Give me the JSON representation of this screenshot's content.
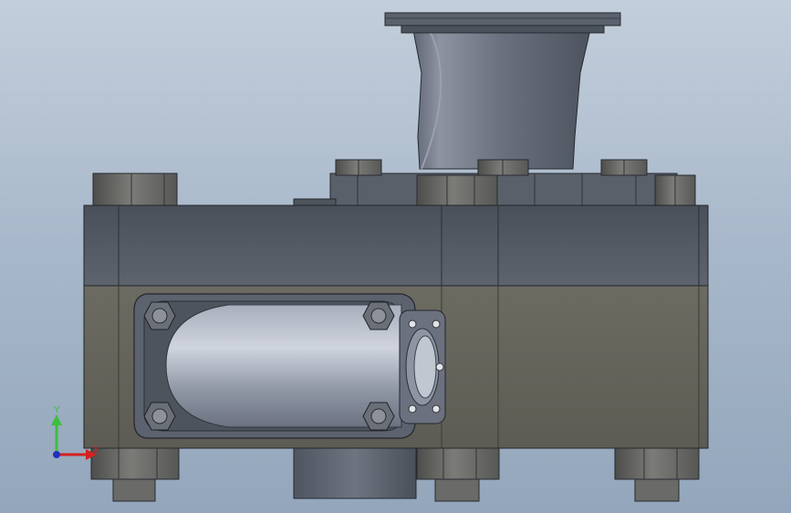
{
  "viewport": {
    "colors": {
      "background_top": "#c3cedb",
      "background_bottom": "#93a6bb",
      "housing_upper": "#565c66",
      "housing_lower": "#66655d",
      "bolt": "#6e6e6c",
      "pipe": "#7d8391"
    }
  },
  "triad": {
    "y_label": "Y",
    "x_label": "X",
    "y_color": "#3cbf3c",
    "x_color": "#d42020",
    "z_color": "#2030c0"
  }
}
